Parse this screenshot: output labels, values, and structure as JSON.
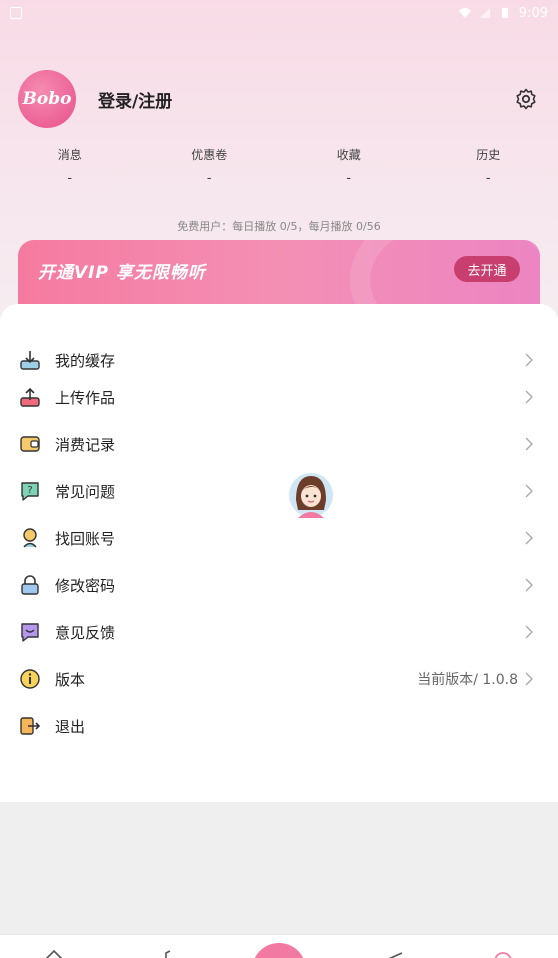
{
  "status_bar": {
    "time": "9:09"
  },
  "profile": {
    "avatar_text": "Bobo",
    "login_label": "登录/注册"
  },
  "stats": [
    {
      "label": "消息",
      "value": "-"
    },
    {
      "label": "优惠卷",
      "value": "-"
    },
    {
      "label": "收藏",
      "value": "-"
    },
    {
      "label": "历史",
      "value": "-"
    }
  ],
  "free_note": "免费用户：每日播放 0/5，每月播放 0/56",
  "vip": {
    "title": "开通VIP 享无限畅听",
    "button_label": "去开通"
  },
  "menu": [
    {
      "label": "我的缓存",
      "icon": "download-icon"
    },
    {
      "label": "上传作品",
      "icon": "upload-icon"
    },
    {
      "label": "消费记录",
      "icon": "wallet-icon"
    },
    {
      "label": "常见问题",
      "icon": "question-icon"
    },
    {
      "label": "找回账号",
      "icon": "account-icon"
    },
    {
      "label": "修改密码",
      "icon": "lock-icon"
    },
    {
      "label": "意见反馈",
      "icon": "feedback-icon"
    },
    {
      "label": "版本",
      "icon": "info-icon",
      "value": "当前版本/ 1.0.8"
    },
    {
      "label": "退出",
      "icon": "logout-icon"
    }
  ],
  "colors": {
    "accent": "#f27aa2",
    "vip_button": "#c83e6e"
  }
}
